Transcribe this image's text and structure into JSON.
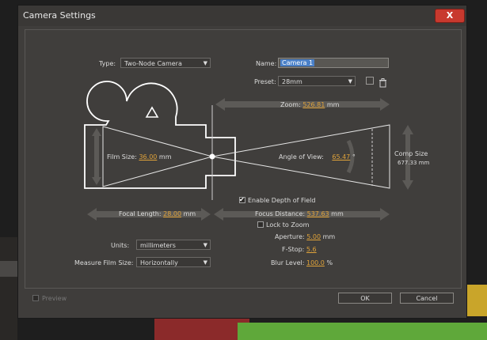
{
  "dialog": {
    "title": "Camera Settings",
    "close_label": "X",
    "colors": {
      "accent_value": "#e0a33a",
      "close_button": "#c8392e",
      "selection": "#4a80c8"
    }
  },
  "type": {
    "label": "Type:",
    "value": "Two-Node Camera"
  },
  "name": {
    "label": "Name:",
    "value": "Camera 1"
  },
  "preset": {
    "label": "Preset:",
    "value": "28mm"
  },
  "zoom": {
    "label": "Zoom:",
    "value": "526.81",
    "unit": "mm"
  },
  "film_size": {
    "label": "Film Size:",
    "value": "36.00",
    "unit": "mm"
  },
  "angle_of_view": {
    "label": "Angle of View:",
    "value": "65.47",
    "unit": "°"
  },
  "comp_size": {
    "label_line1": "Comp Size",
    "value": "677.33 mm"
  },
  "depth_of_field": {
    "label": "Enable Depth of Field",
    "checked": true
  },
  "focal_length": {
    "label": "Focal Length:",
    "value": "28.00",
    "unit": "mm"
  },
  "focus_distance": {
    "label": "Focus Distance:",
    "value": "537.63",
    "unit": "mm"
  },
  "lock_to_zoom": {
    "label": "Lock to Zoom",
    "checked": false
  },
  "aperture": {
    "label": "Aperture:",
    "value": "5.00",
    "unit": "mm"
  },
  "fstop": {
    "label": "F-Stop:",
    "value": "5.6"
  },
  "blur_level": {
    "label": "Blur Level:",
    "value": "100.0",
    "unit": "%"
  },
  "units": {
    "label": "Units:",
    "value": "millimeters"
  },
  "measure_film_size": {
    "label": "Measure Film Size:",
    "value": "Horizontally"
  },
  "footer": {
    "preview_label": "Preview",
    "ok_label": "OK",
    "cancel_label": "Cancel"
  },
  "icons": [
    "save-preset-icon",
    "trash-icon",
    "dropdown-arrow-icon",
    "camera-diagram"
  ]
}
